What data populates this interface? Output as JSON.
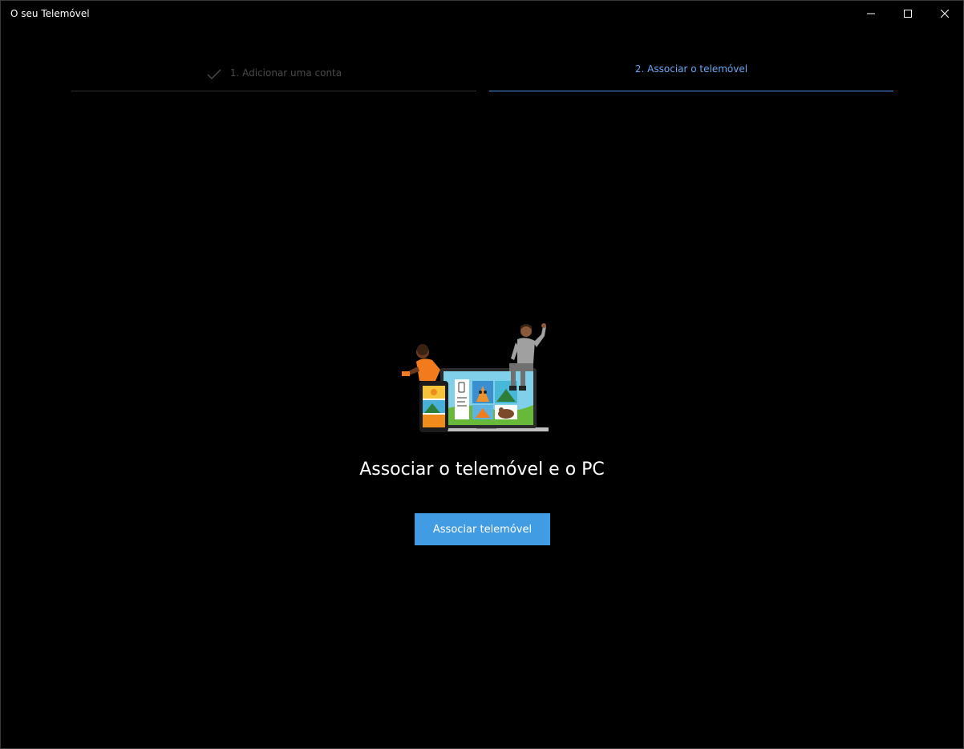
{
  "window": {
    "title": "O seu Telemóvel",
    "controls": {
      "minimize_icon": "minimize-icon",
      "maximize_icon": "maximize-icon",
      "close_icon": "close-icon"
    }
  },
  "steps": [
    {
      "label": "1. Adicionar uma conta",
      "state": "completed",
      "icon": "check-icon"
    },
    {
      "label": "2. Associar o telemóvel",
      "state": "active"
    }
  ],
  "main": {
    "illustration": "people-devices-illustration",
    "heading": "Associar o telemóvel e o PC",
    "button_label": "Associar telemóvel"
  },
  "colors": {
    "background": "#000000",
    "accent": "#429ce3",
    "active_step_text": "#6aa8f5",
    "inactive_step_text": "#4a4a4a"
  }
}
